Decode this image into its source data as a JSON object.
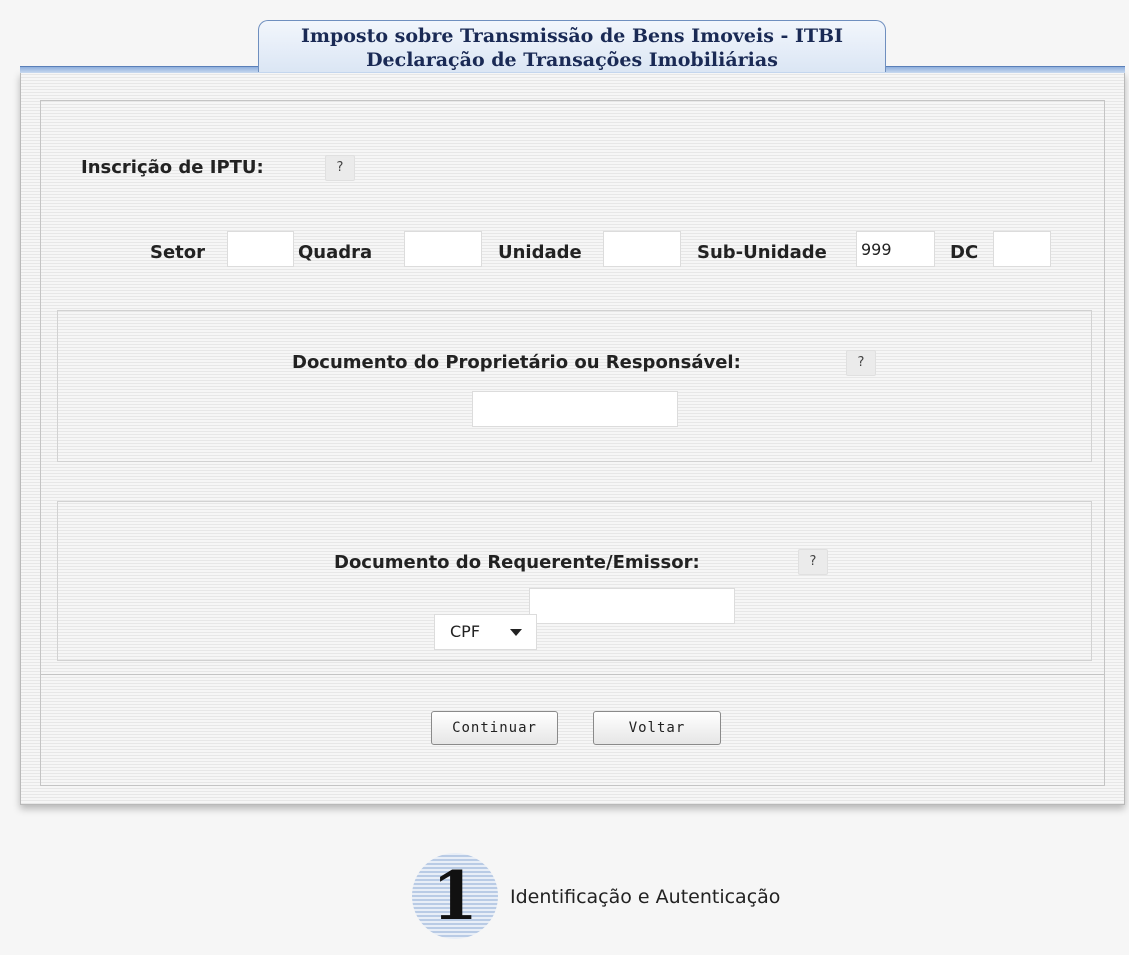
{
  "header": {
    "title_line1": "Imposto sobre Transmissão de Bens Imoveis - ITBI",
    "title_line2": "Declaração de Transações Imobiliárias"
  },
  "iptu": {
    "label": "Inscrição de IPTU:",
    "help": "?",
    "setor_label": "Setor",
    "setor_value": "",
    "quadra_label": "Quadra",
    "quadra_value": "",
    "unidade_label": "Unidade",
    "unidade_value": "",
    "subunidade_label": "Sub-Unidade",
    "subunidade_value": "999",
    "dc_label": "DC",
    "dc_value": ""
  },
  "proprietario": {
    "label": "Documento do Proprietário ou Responsável:",
    "help": "?",
    "value": ""
  },
  "requerente": {
    "label": "Documento do Requerente/Emissor:",
    "help": "?",
    "doc_type": "CPF",
    "value": ""
  },
  "buttons": {
    "continue": "Continuar",
    "back": "Voltar"
  },
  "step": {
    "number": "1",
    "label": "Identificação e Autenticação"
  }
}
